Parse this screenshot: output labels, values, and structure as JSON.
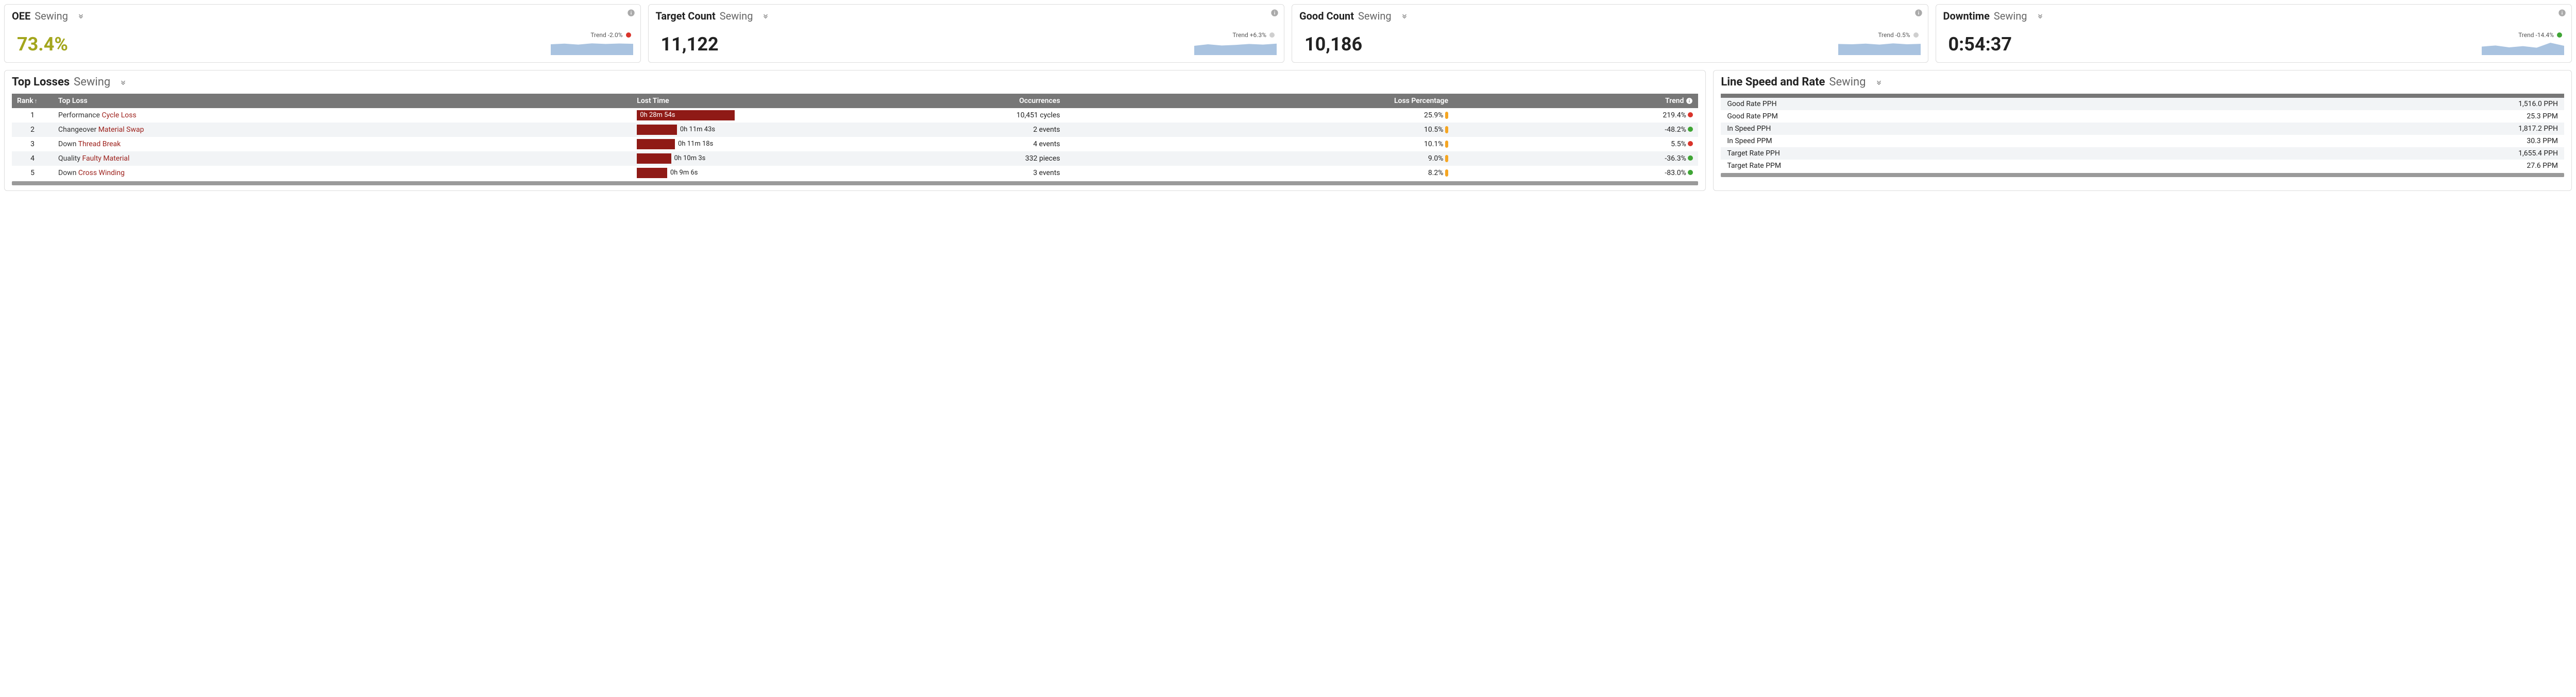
{
  "kpis": [
    {
      "title": "OEE",
      "scope": "Sewing",
      "value": "73.4%",
      "value_style": "olive",
      "trend_label": "Trend -2.0%",
      "trend_dot": "red"
    },
    {
      "title": "Target Count",
      "scope": "Sewing",
      "value": "11,122",
      "value_style": "",
      "trend_label": "Trend +6.3%",
      "trend_dot": "grey"
    },
    {
      "title": "Good Count",
      "scope": "Sewing",
      "value": "10,186",
      "value_style": "",
      "trend_label": "Trend -0.5%",
      "trend_dot": "grey"
    },
    {
      "title": "Downtime",
      "scope": "Sewing",
      "value": "0:54:37",
      "value_style": "",
      "trend_label": "Trend -14.4%",
      "trend_dot": "green"
    }
  ],
  "losses": {
    "title": "Top Losses",
    "scope": "Sewing",
    "columns": {
      "rank": "Rank",
      "top_loss": "Top Loss",
      "lost_time": "Lost Time",
      "occurrences": "Occurrences",
      "loss_pct": "Loss Percentage",
      "trend": "Trend"
    },
    "rows": [
      {
        "rank": "1",
        "category": "Performance",
        "name": "Cycle Loss",
        "lost_time": "0h 28m 54s",
        "bar_pct": 100,
        "label_inside": true,
        "occurrences": "10,451 cycles",
        "loss_pct": "25.9%",
        "trend": "219.4%",
        "trend_dot": "red"
      },
      {
        "rank": "2",
        "category": "Changeover",
        "name": "Material Swap",
        "lost_time": "0h 11m 43s",
        "bar_pct": 41,
        "label_inside": false,
        "occurrences": "2 events",
        "loss_pct": "10.5%",
        "trend": "-48.2%",
        "trend_dot": "green"
      },
      {
        "rank": "3",
        "category": "Down",
        "name": "Thread Break",
        "lost_time": "0h 11m 18s",
        "bar_pct": 39,
        "label_inside": false,
        "occurrences": "4 events",
        "loss_pct": "10.1%",
        "trend": "5.5%",
        "trend_dot": "red"
      },
      {
        "rank": "4",
        "category": "Quality",
        "name": "Faulty Material",
        "lost_time": "0h 10m 3s",
        "bar_pct": 35,
        "label_inside": false,
        "occurrences": "332 pieces",
        "loss_pct": "9.0%",
        "trend": "-36.3%",
        "trend_dot": "green"
      },
      {
        "rank": "5",
        "category": "Down",
        "name": "Cross Winding",
        "lost_time": "0h 9m 6s",
        "bar_pct": 31,
        "label_inside": false,
        "occurrences": "3 events",
        "loss_pct": "8.2%",
        "trend": "-83.0%",
        "trend_dot": "green"
      }
    ]
  },
  "rates": {
    "title": "Line Speed and Rate",
    "scope": "Sewing",
    "rows": [
      {
        "label": "Good Rate PPH",
        "value": "1,516.0 PPH"
      },
      {
        "label": "Good Rate PPM",
        "value": "25.3 PPM"
      },
      {
        "label": "In Speed PPH",
        "value": "1,817.2 PPH"
      },
      {
        "label": "In Speed PPM",
        "value": "30.3 PPM"
      },
      {
        "label": "Target Rate PPH",
        "value": "1,655.4 PPH"
      },
      {
        "label": "Target Rate PPM",
        "value": "27.6 PPM"
      }
    ]
  },
  "chart_data": [
    {
      "type": "area",
      "name": "OEE sparkline",
      "y": [
        70,
        74,
        68,
        76,
        72,
        75,
        73
      ],
      "ylim": [
        0,
        100
      ]
    },
    {
      "type": "area",
      "name": "Target Count sparkline",
      "y": [
        60,
        70,
        62,
        66,
        72,
        68,
        74
      ],
      "ylim": [
        0,
        100
      ]
    },
    {
      "type": "area",
      "name": "Good Count sparkline",
      "y": [
        72,
        70,
        74,
        68,
        76,
        70,
        73
      ],
      "ylim": [
        0,
        100
      ]
    },
    {
      "type": "area",
      "name": "Downtime sparkline",
      "y": [
        55,
        62,
        50,
        58,
        48,
        80,
        60
      ],
      "ylim": [
        0,
        100
      ]
    }
  ]
}
